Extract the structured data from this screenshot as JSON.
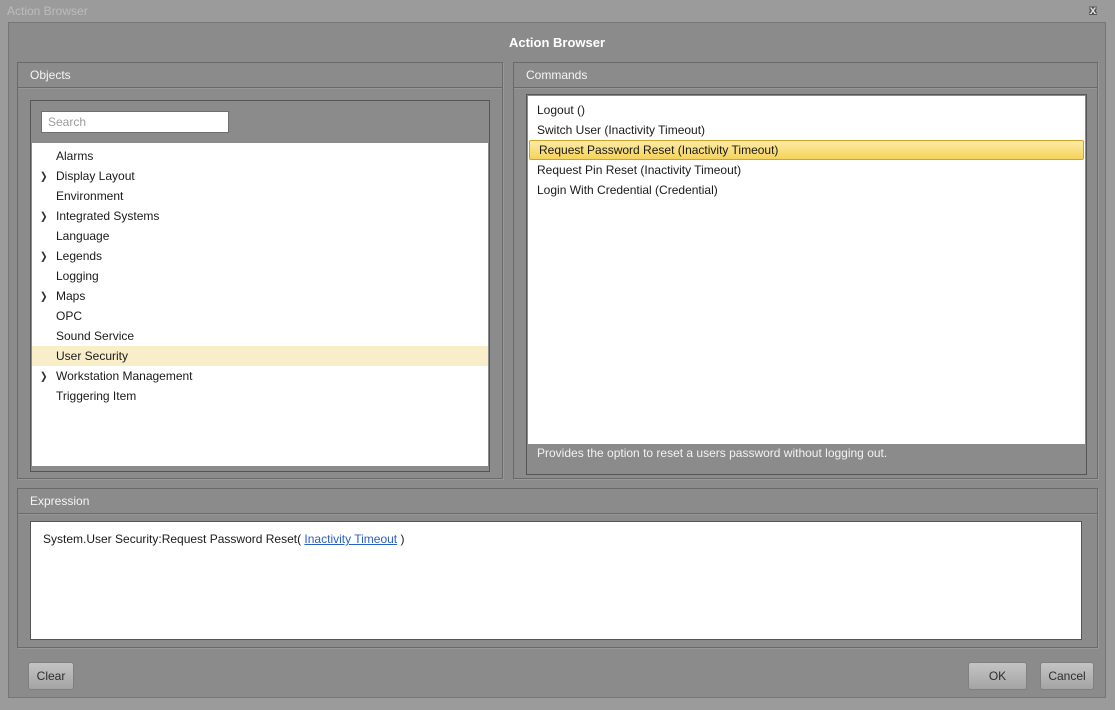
{
  "window": {
    "title": "Action Browser",
    "heading": "Action Browser"
  },
  "icons": {
    "close": "x",
    "chevron": "❯"
  },
  "objects_panel": {
    "label": "Objects",
    "search_placeholder": "Search",
    "tree": [
      {
        "label": "Alarms",
        "expandable": false,
        "selected": false
      },
      {
        "label": "Display Layout",
        "expandable": true,
        "selected": false
      },
      {
        "label": "Environment",
        "expandable": false,
        "selected": false
      },
      {
        "label": "Integrated Systems",
        "expandable": true,
        "selected": false
      },
      {
        "label": "Language",
        "expandable": false,
        "selected": false
      },
      {
        "label": "Legends",
        "expandable": true,
        "selected": false
      },
      {
        "label": "Logging",
        "expandable": false,
        "selected": false
      },
      {
        "label": "Maps",
        "expandable": true,
        "selected": false
      },
      {
        "label": "OPC",
        "expandable": false,
        "selected": false
      },
      {
        "label": "Sound Service",
        "expandable": false,
        "selected": false
      },
      {
        "label": "User Security",
        "expandable": false,
        "selected": true
      },
      {
        "label": "Workstation Management",
        "expandable": true,
        "selected": false
      },
      {
        "label": "Triggering Item",
        "expandable": false,
        "selected": false
      }
    ]
  },
  "commands_panel": {
    "label": "Commands",
    "items": [
      {
        "label": "Logout ()",
        "selected": false
      },
      {
        "label": "Switch User (Inactivity Timeout)",
        "selected": false
      },
      {
        "label": "Request Password Reset (Inactivity Timeout)",
        "selected": true
      },
      {
        "label": "Request Pin Reset (Inactivity Timeout)",
        "selected": false
      },
      {
        "label": "Login With Credential (Credential)",
        "selected": false
      }
    ],
    "description": "Provides the option to reset a users password without logging out."
  },
  "expression_panel": {
    "label": "Expression",
    "prefix": "System.User Security:Request Password Reset( ",
    "link": "Inactivity Timeout",
    "suffix": " )"
  },
  "buttons": {
    "clear": "Clear",
    "ok": "OK",
    "cancel": "Cancel"
  },
  "colors": {
    "outer-bg": "#9b9b9b",
    "dialog-bg": "#8b8b8b",
    "title-text": "#bcbcbc",
    "tree-selected-bg": "#f8efca",
    "cmd-selected-top": "#fdeba3",
    "cmd-selected-bottom": "#f5d35c",
    "cmd-selected-border": "#cfa42c",
    "link-blue": "#2a5fc4"
  }
}
